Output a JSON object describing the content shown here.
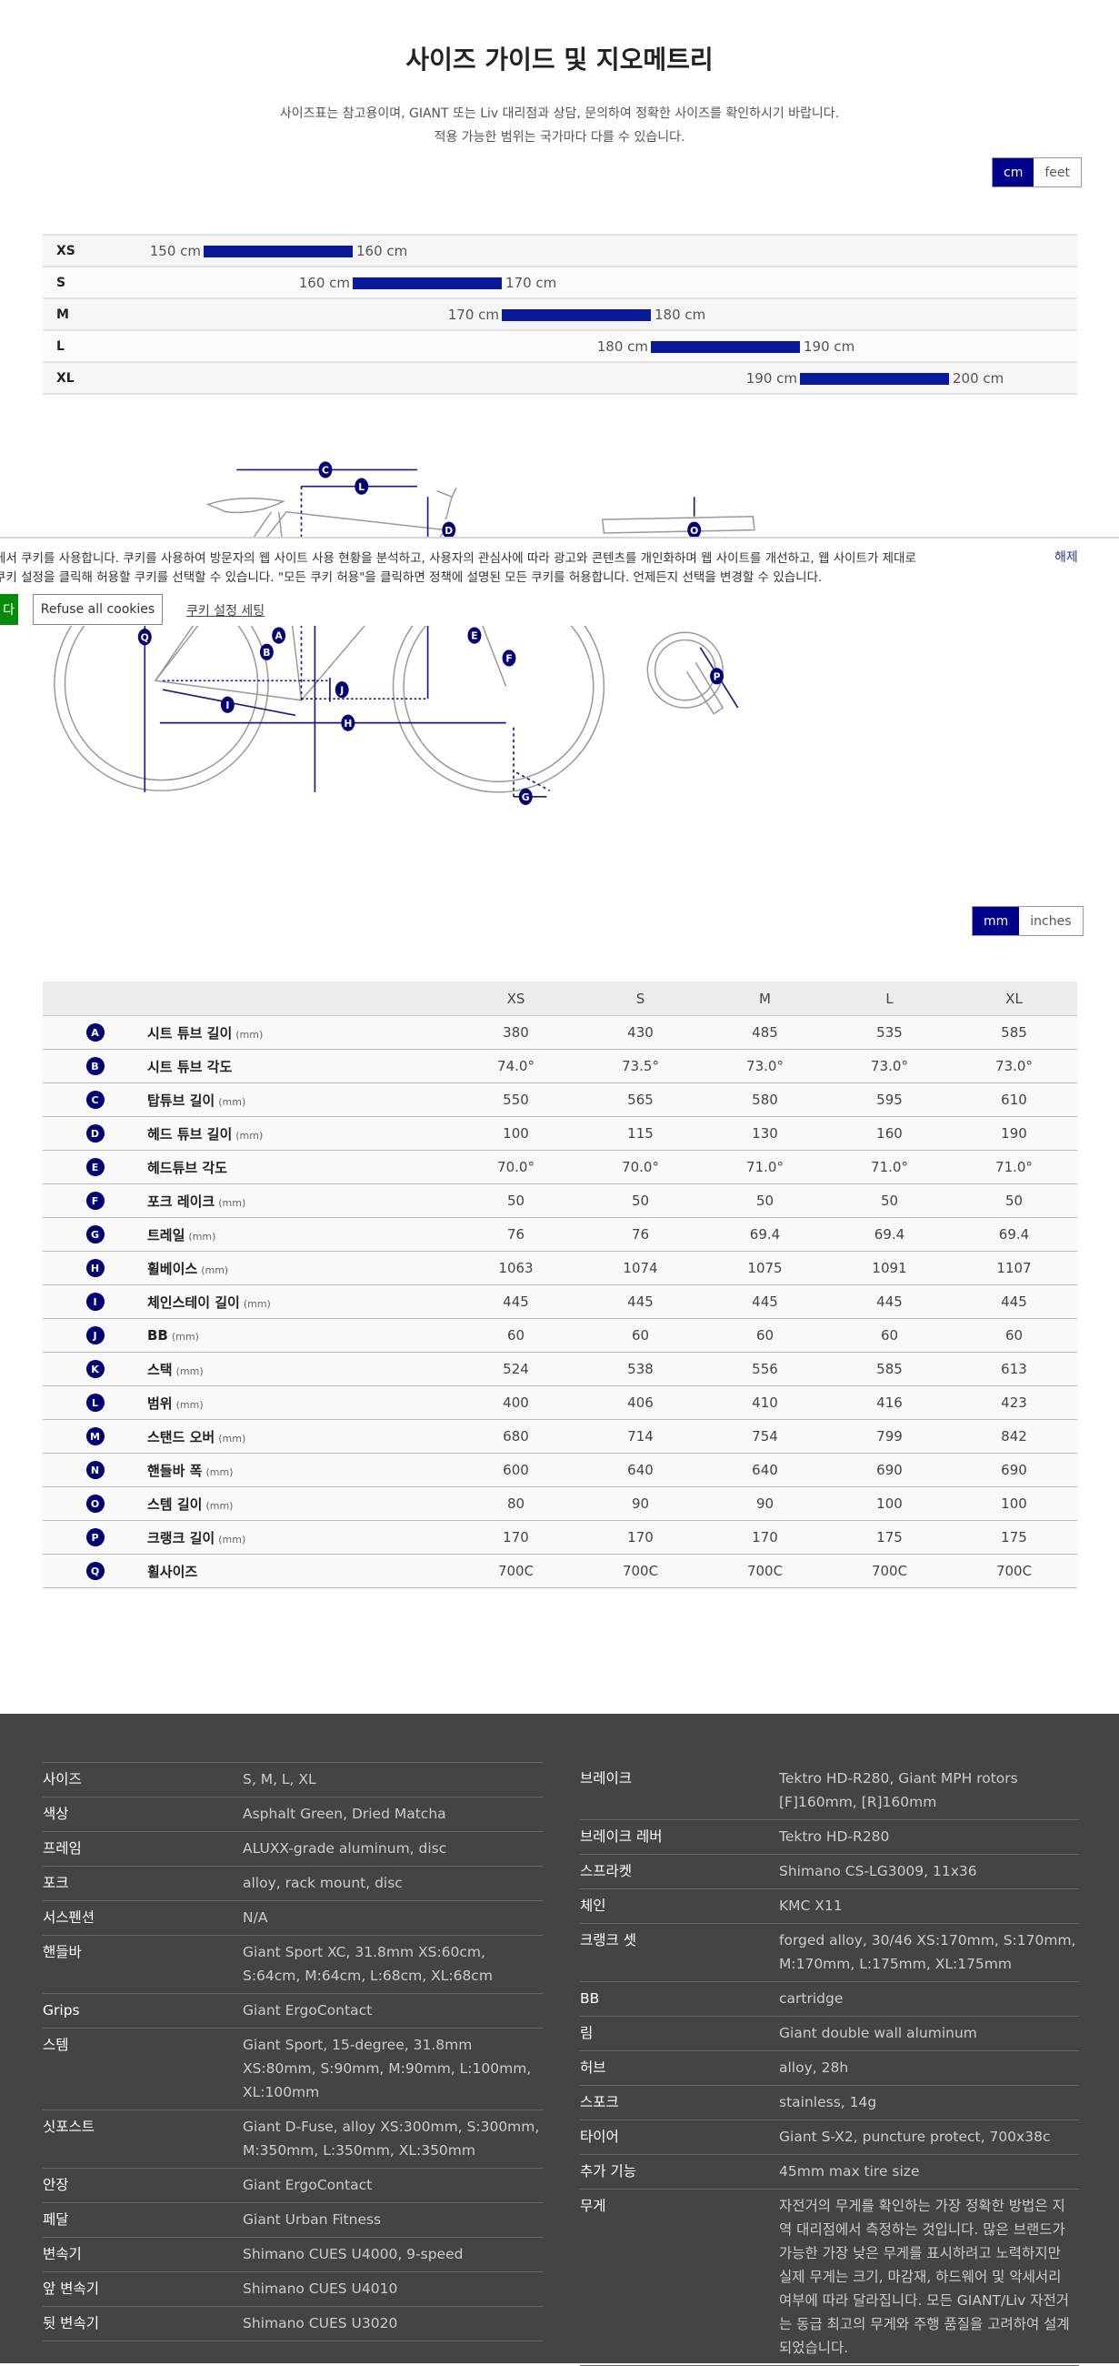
{
  "header": {
    "title": "사이즈 가이드 및 지오메트리",
    "subtitle_1": "사이즈표는 참고용이며, GIANT 또는 Liv 대리점과 상담, 문의하여 정확한 사이즈를 확인하시기 바랍니다.",
    "subtitle_2": "적용 가능한 범위는 국가마다 다를 수 있습니다."
  },
  "height_units": {
    "options": [
      "cm",
      "feet"
    ],
    "selected": "cm"
  },
  "size_chart": {
    "unit": "cm",
    "bar_color": "#0a1a9a",
    "range": [
      150,
      200
    ],
    "rows": [
      {
        "size": "XS",
        "min": 150,
        "max": 160,
        "min_label": "150 cm",
        "max_label": "160 cm"
      },
      {
        "size": "S",
        "min": 160,
        "max": 170,
        "min_label": "160 cm",
        "max_label": "170 cm"
      },
      {
        "size": "M",
        "min": 170,
        "max": 180,
        "min_label": "170 cm",
        "max_label": "180 cm"
      },
      {
        "size": "L",
        "min": 180,
        "max": 190,
        "min_label": "180 cm",
        "max_label": "190 cm"
      },
      {
        "size": "XL",
        "min": 190,
        "max": 200,
        "min_label": "190 cm",
        "max_label": "200 cm"
      }
    ]
  },
  "diagram_labels": [
    "A",
    "B",
    "C",
    "D",
    "E",
    "F",
    "G",
    "H",
    "I",
    "J",
    "L",
    "O",
    "P",
    "Q"
  ],
  "cookie_banner": {
    "line_1": "에서 쿠키를 사용합니다. 쿠키를 사용하여 방문자의 웹 사이트 사용 현황을 분석하고, 사용자의 관심사에 따라 광고와 콘텐츠를 개인화하며 웹 사이트를 개선하고, 웹 사이트가 제대로",
    "line_2": "쿠키 설정을 클릭해 허용할 쿠키를 선택할 수 있습니다. \"모든 쿠키 허용\"을 클릭하면 정책에 설명된 모든 쿠키를 허용합니다. 언제든지 선택을 변경할 수 있습니다.",
    "accept_label": "다",
    "refuse_label": "Refuse all cookies",
    "settings_label": "쿠키 설정 세팅",
    "close_label": "해제",
    "accept_color": "#0a8a0a"
  },
  "length_units": {
    "options": [
      "mm",
      "inches"
    ],
    "selected": "mm"
  },
  "geometry": {
    "badge_color": "#020072",
    "sizes": [
      "XS",
      "S",
      "M",
      "L",
      "XL"
    ],
    "rows": [
      {
        "letter": "A",
        "label": "시트 튜브 길이",
        "unit": "(mm)",
        "values": [
          "380",
          "430",
          "485",
          "535",
          "585"
        ]
      },
      {
        "letter": "B",
        "label": "시트 튜브 각도",
        "unit": "",
        "values": [
          "74.0°",
          "73.5°",
          "73.0°",
          "73.0°",
          "73.0°"
        ]
      },
      {
        "letter": "C",
        "label": "탑튜브 길이",
        "unit": "(mm)",
        "values": [
          "550",
          "565",
          "580",
          "595",
          "610"
        ]
      },
      {
        "letter": "D",
        "label": "헤드 튜브 길이",
        "unit": "(mm)",
        "values": [
          "100",
          "115",
          "130",
          "160",
          "190"
        ]
      },
      {
        "letter": "E",
        "label": "헤드튜브 각도",
        "unit": "",
        "values": [
          "70.0°",
          "70.0°",
          "71.0°",
          "71.0°",
          "71.0°"
        ]
      },
      {
        "letter": "F",
        "label": "포크 레이크",
        "unit": "(mm)",
        "values": [
          "50",
          "50",
          "50",
          "50",
          "50"
        ]
      },
      {
        "letter": "G",
        "label": "트레일",
        "unit": "(mm)",
        "values": [
          "76",
          "76",
          "69.4",
          "69.4",
          "69.4"
        ]
      },
      {
        "letter": "H",
        "label": "휠베이스",
        "unit": "(mm)",
        "values": [
          "1063",
          "1074",
          "1075",
          "1091",
          "1107"
        ]
      },
      {
        "letter": "I",
        "label": "체인스테이 길이",
        "unit": "(mm)",
        "values": [
          "445",
          "445",
          "445",
          "445",
          "445"
        ]
      },
      {
        "letter": "J",
        "label": "BB",
        "unit": "(mm)",
        "values": [
          "60",
          "60",
          "60",
          "60",
          "60"
        ]
      },
      {
        "letter": "K",
        "label": "스택",
        "unit": "(mm)",
        "values": [
          "524",
          "538",
          "556",
          "585",
          "613"
        ]
      },
      {
        "letter": "L",
        "label": "범위",
        "unit": "(mm)",
        "values": [
          "400",
          "406",
          "410",
          "416",
          "423"
        ]
      },
      {
        "letter": "M",
        "label": "스탠드 오버",
        "unit": "(mm)",
        "values": [
          "680",
          "714",
          "754",
          "799",
          "842"
        ]
      },
      {
        "letter": "N",
        "label": "핸들바 폭",
        "unit": "(mm)",
        "values": [
          "600",
          "640",
          "640",
          "690",
          "690"
        ]
      },
      {
        "letter": "O",
        "label": "스템 길이",
        "unit": "(mm)",
        "values": [
          "80",
          "90",
          "90",
          "100",
          "100"
        ]
      },
      {
        "letter": "P",
        "label": "크랭크 길이",
        "unit": "(mm)",
        "values": [
          "170",
          "170",
          "170",
          "175",
          "175"
        ]
      },
      {
        "letter": "Q",
        "label": "휠사이즈",
        "unit": "",
        "values": [
          "700C",
          "700C",
          "700C",
          "700C",
          "700C"
        ]
      }
    ]
  },
  "specs": {
    "left": [
      {
        "k": "사이즈",
        "v": "S, M, L, XL"
      },
      {
        "k": "색상",
        "v": "Asphalt Green, Dried Matcha"
      },
      {
        "k": "프레임",
        "v": "ALUXX-grade aluminum, disc"
      },
      {
        "k": "포크",
        "v": "alloy, rack mount, disc"
      },
      {
        "k": "서스펜션",
        "v": "N/A"
      },
      {
        "k": "핸들바",
        "v": "Giant Sport XC, 31.8mm XS:60cm, S:64cm, M:64cm, L:68cm, XL:68cm"
      },
      {
        "k": "Grips",
        "v": "Giant ErgoContact"
      },
      {
        "k": "스템",
        "v": "Giant Sport, 15-degree, 31.8mm XS:80mm, S:90mm, M:90mm, L:100mm, XL:100mm"
      },
      {
        "k": "싯포스트",
        "v": "Giant D-Fuse, alloy XS:300mm, S:300mm, M:350mm, L:350mm, XL:350mm"
      },
      {
        "k": "안장",
        "v": "Giant ErgoContact"
      },
      {
        "k": "페달",
        "v": "Giant Urban Fitness"
      },
      {
        "k": "변속기",
        "v": "Shimano CUES U4000, 9-speed"
      },
      {
        "k": "앞 변속기",
        "v": "Shimano CUES U4010"
      },
      {
        "k": "뒷 변속기",
        "v": "Shimano CUES U3020"
      }
    ],
    "right": [
      {
        "k": "브레이크",
        "v": "Tektro HD-R280, Giant MPH rotors [F]160mm, [R]160mm"
      },
      {
        "k": "브레이크 레버",
        "v": "Tektro HD-R280"
      },
      {
        "k": "스프라켓",
        "v": "Shimano CS-LG3009, 11x36"
      },
      {
        "k": "체인",
        "v": "KMC X11"
      },
      {
        "k": "크랭크 셋",
        "v": "forged alloy, 30/46 XS:170mm, S:170mm, M:170mm, L:175mm, XL:175mm"
      },
      {
        "k": "BB",
        "v": "cartridge"
      },
      {
        "k": "림",
        "v": "Giant double wall aluminum"
      },
      {
        "k": "허브",
        "v": "alloy, 28h"
      },
      {
        "k": "스포크",
        "v": "stainless, 14g"
      },
      {
        "k": "타이어",
        "v": "Giant S-X2, puncture protect, 700x38c"
      },
      {
        "k": "추가 기능",
        "v": "45mm max tire size"
      },
      {
        "k": "무게",
        "v": "자전거의 무게를 확인하는 가장 정확한 방법은 지역 대리점에서 측정하는 것입니다. 많은 브랜드가 가능한 가장 낮은 무게를 표시하려고 노력하지만 실제 무게는 크기, 마감재, 하드웨어 및 악세서리 여부에 따라 달라집니다. 모든 GIANT/Liv 자전거는 동급 최고의 무게와 주행 품질을 고려하여 설계되었습니다."
      }
    ]
  }
}
